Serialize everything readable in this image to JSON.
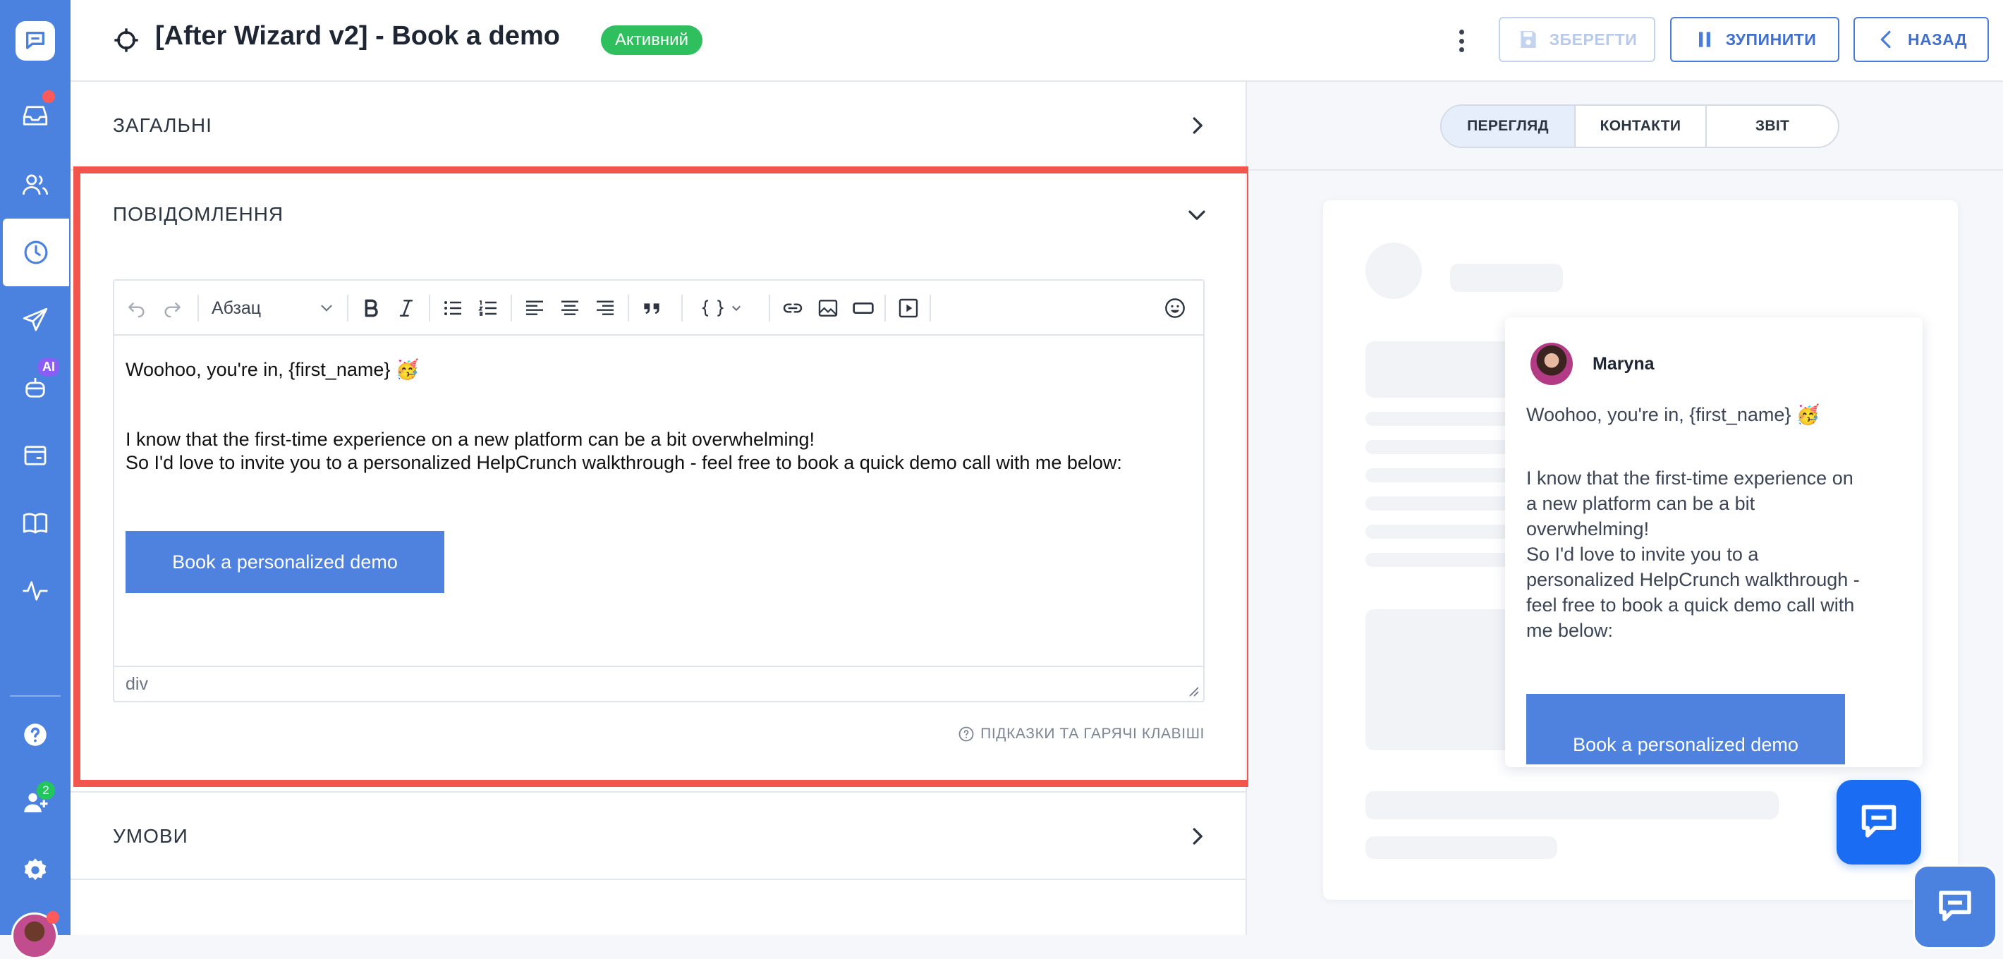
{
  "header": {
    "title": "[After Wizard v2] - Book a demo",
    "status_badge": "Активний",
    "save_label": "ЗБЕРЕГТИ",
    "stop_label": "ЗУПИНИТИ",
    "back_label": "НАЗАД"
  },
  "sidebar": {
    "items": [
      "chat-logo-icon",
      "inbox-icon",
      "contacts-icon",
      "automations-icon",
      "campaigns-icon",
      "ai-bot-icon",
      "widgets-icon",
      "knowledge-base-icon",
      "reports-icon",
      "help-icon",
      "team-icon",
      "settings-icon"
    ],
    "ai_badge": "AI",
    "team_count": "2"
  },
  "sections": {
    "general": "ЗАГАЛЬНІ",
    "message": "ПОВІДОМЛЕННЯ",
    "conditions": "УМОВИ"
  },
  "editor": {
    "block_format": "Абзац",
    "greeting": "Woohoo, you're in, {first_name} 🥳",
    "line1": "I know that the first-time experience on a new platform can be a bit overwhelming!",
    "line2": "So I'd love to invite you to a personalized HelpCrunch walkthrough - feel free to book a quick demo call with me below:",
    "button_label": "Book a personalized demo",
    "path": "div",
    "hints_label": "ПІДКАЗКИ ТА ГАРЯЧІ КЛАВІШІ"
  },
  "preview_tabs": [
    "ПЕРЕГЛЯД",
    "КОНТАКТИ",
    "ЗВІТ"
  ],
  "preview": {
    "agent_name": "Maryna",
    "greeting": "Woohoo, you're in, {first_name} 🥳",
    "lines": [
      "I know that the first-time experience on",
      "a new platform can be a bit",
      "overwhelming!",
      "So I'd love to invite you to a",
      "personalized HelpCrunch walkthrough -",
      "feel free to book a quick demo call with",
      "me below:"
    ],
    "button_label": "Book a personalized demo"
  },
  "colors": {
    "accent": "#4b82e0",
    "active_badge": "#2fbf5e",
    "highlight": "#f2554b",
    "launcher": "#1a6cf2"
  }
}
